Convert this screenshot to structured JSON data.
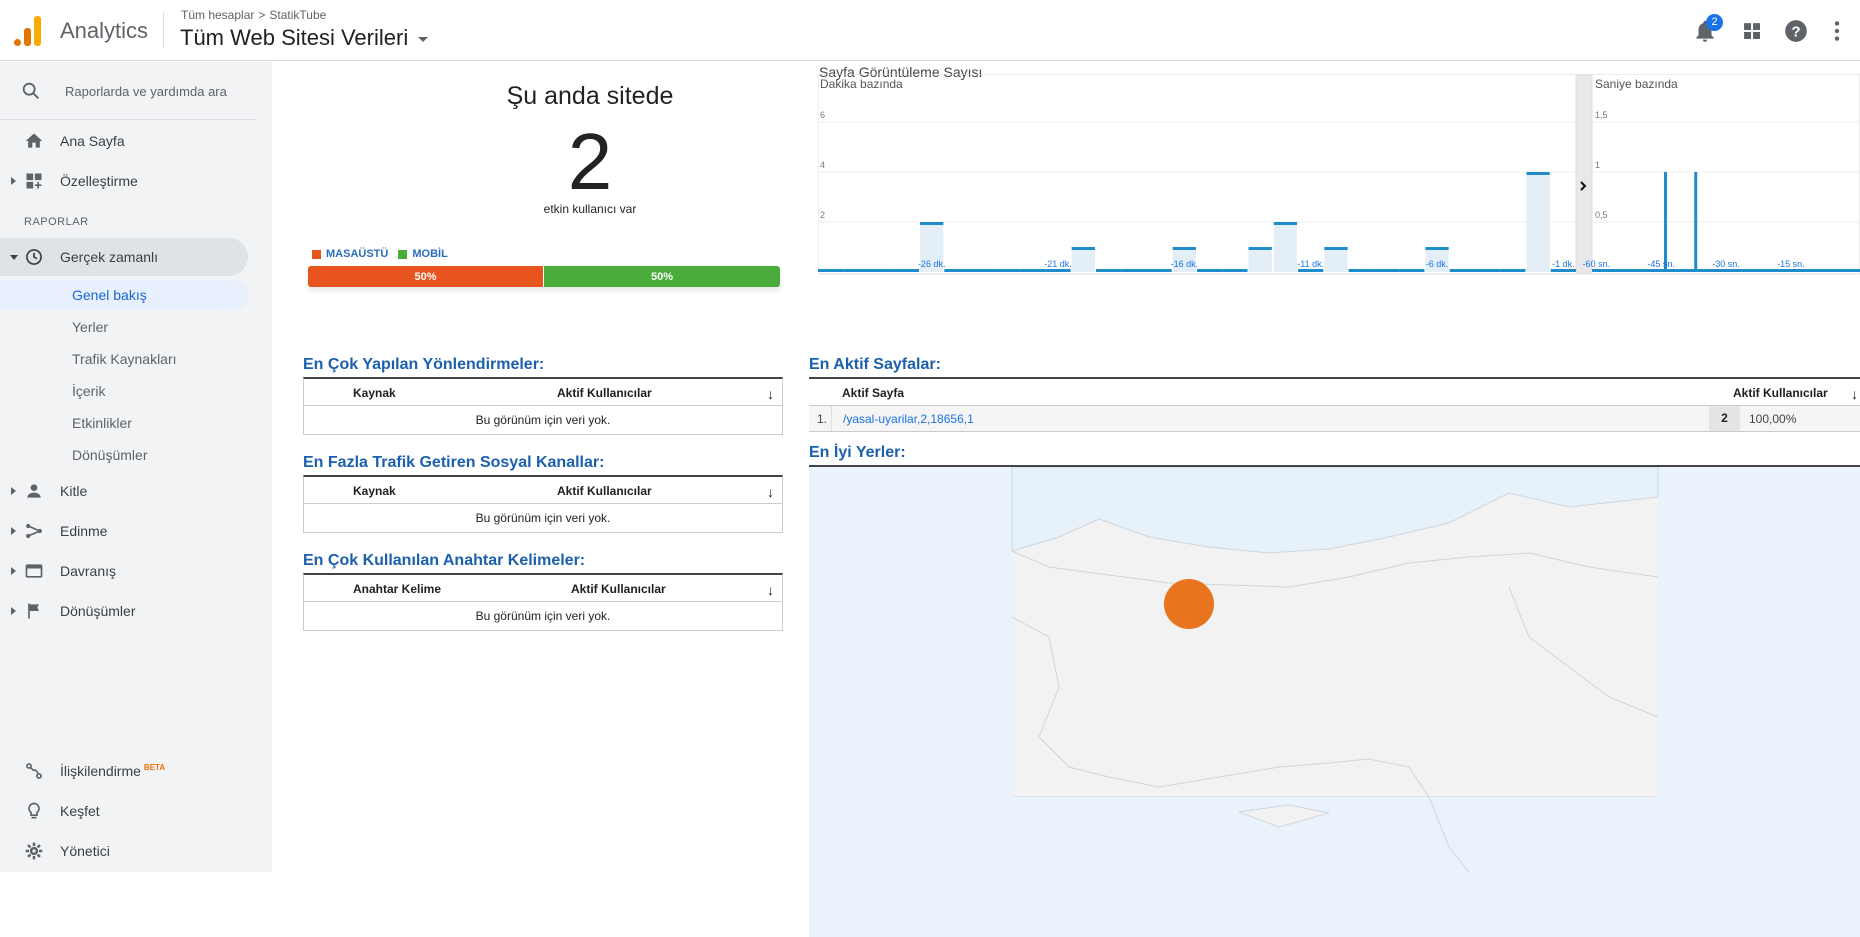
{
  "header": {
    "app_name": "Analytics",
    "breadcrumb_root": "Tüm hesaplar",
    "breadcrumb_sep": ">",
    "breadcrumb_account": "StatikTube",
    "view_title": "Tüm Web Sitesi Verileri",
    "notification_count": "2"
  },
  "sidebar": {
    "search_placeholder": "Raporlarda ve yardımda ara",
    "home": "Ana Sayfa",
    "customize": "Özelleştirme",
    "reports_header": "RAPORLAR",
    "realtime": "Gerçek zamanlı",
    "realtime_items": [
      "Genel bakış",
      "Yerler",
      "Trafik Kaynakları",
      "İçerik",
      "Etkinlikler",
      "Dönüşümler"
    ],
    "audience": "Kitle",
    "acquisition": "Edinme",
    "behavior": "Davranış",
    "conversions": "Dönüşümler",
    "attribution": "İlişkilendirme",
    "attribution_badge": "BETA",
    "discover": "Keşfet",
    "admin": "Yönetici"
  },
  "overview": {
    "title": "Şu anda sitede",
    "active_users": "2",
    "subtitle": "etkin kullanıcı var",
    "legend_desktop": "MASAÜSTÜ",
    "legend_mobile": "MOBİL",
    "desktop_pct": "50%",
    "mobile_pct": "50%",
    "desktop_fraction": 0.5,
    "colors": {
      "desktop": "#e8541e",
      "mobile": "#4aad3b"
    }
  },
  "tables": {
    "referrals": {
      "title": "En Çok Yapılan Yönlendirmeler:",
      "col1": "Kaynak",
      "col2": "Aktif Kullanıcılar",
      "sort": "↓",
      "empty": "Bu görünüm için veri yok."
    },
    "social": {
      "title": "En Fazla Trafik Getiren Sosyal Kanallar:",
      "col1": "Kaynak",
      "col2": "Aktif Kullanıcılar",
      "sort": "↓",
      "empty": "Bu görünüm için veri yok."
    },
    "keywords": {
      "title": "En Çok Kullanılan Anahtar Kelimeler:",
      "col1": "Anahtar Kelime",
      "col2": "Aktif Kullanıcılar",
      "sort": "↓",
      "empty": "Bu görünüm için veri yok."
    },
    "active_pages": {
      "title": "En Aktif Sayfalar:",
      "col1": "Aktif Sayfa",
      "col2": "Aktif Kullanıcılar",
      "sort": "↓",
      "rows": [
        {
          "rank": "1.",
          "page": "/yasal-uyarilar,2,18656,1",
          "users": "2",
          "pct": "100,00%"
        }
      ]
    },
    "top_locations": {
      "title": "En İyi Yerler:"
    }
  },
  "chart_data": [
    {
      "type": "bar",
      "title": "Sayfa Görüntüleme Sayısı",
      "subtitle": "Dakika bazında",
      "x": [
        -30,
        -29,
        -28,
        -27,
        -26,
        -25,
        -24,
        -23,
        -22,
        -21,
        -20,
        -19,
        -18,
        -17,
        -16,
        -15,
        -14,
        -13,
        -12,
        -11,
        -10,
        -9,
        -8,
        -7,
        -6,
        -5,
        -4,
        -3,
        -2,
        -1
      ],
      "tick_labels": [
        "-26 dk.",
        "-21 dk.",
        "-16 dk.",
        "-11 dk.",
        "-6 dk.",
        "-1 dk."
      ],
      "tick_values": [
        -26,
        -21,
        -16,
        -11,
        -6,
        -1
      ],
      "values": [
        0,
        0,
        0,
        0,
        2,
        0,
        0,
        0,
        0,
        0,
        1,
        0,
        0,
        0,
        1,
        0,
        0,
        1,
        2,
        0,
        1,
        0,
        0,
        0,
        1,
        0,
        0,
        0,
        4,
        0
      ],
      "yticks": [
        2,
        4,
        6
      ],
      "ylim": [
        0,
        6
      ]
    },
    {
      "type": "bar",
      "subtitle": "Saniye bazında",
      "tick_labels": [
        "-60 sn.",
        "-45 sn.",
        "-30 sn.",
        "-15 sn."
      ],
      "tick_values": [
        -60,
        -45,
        -30,
        -15
      ],
      "x": [
        -44,
        -37
      ],
      "values": [
        1,
        1
      ],
      "yticks": [
        "0,5",
        "1",
        "1,5"
      ],
      "ytick_values": [
        0.5,
        1,
        1.5
      ],
      "ylim": [
        0,
        1.5
      ]
    }
  ],
  "colors": {
    "accent": "#1a73e8",
    "chart_bar": "#1f8ccc",
    "section_title": "#1c60ad",
    "map_marker": "#e8741e"
  }
}
